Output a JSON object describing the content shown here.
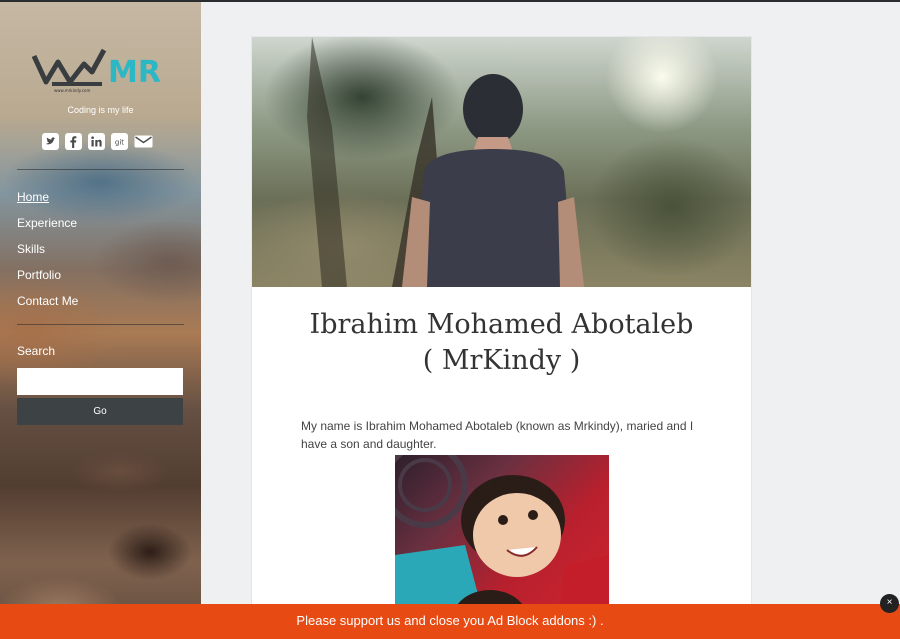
{
  "site": {
    "logo_text": "MR",
    "logo_arabic": "كندي",
    "logo_url_text": "www.mrkindy.com",
    "tagline": "Coding is my life"
  },
  "social": [
    {
      "name": "twitter-icon"
    },
    {
      "name": "facebook-icon"
    },
    {
      "name": "linkedin-icon"
    },
    {
      "name": "git-icon",
      "label": "git"
    },
    {
      "name": "email-icon"
    }
  ],
  "nav": {
    "items": [
      {
        "label": "Home",
        "active": true
      },
      {
        "label": "Experience"
      },
      {
        "label": "Skills"
      },
      {
        "label": "Portfolio"
      },
      {
        "label": "Contact Me"
      }
    ]
  },
  "search": {
    "label": "Search",
    "value": "",
    "button_label": "Go"
  },
  "post": {
    "title_line1": "Ibrahim Mohamed Abotaleb",
    "title_line2": "( MrKindy )",
    "intro": "My name is Ibrahim Mohamed Abotaleb (known as Mrkindy), maried and I have a son and daughter."
  },
  "adblock": {
    "message": "Please support us and close you Ad Block addons :) .",
    "close_label": "×"
  },
  "colors": {
    "accent": "#e84a14",
    "logo_teal": "#2bb8c4",
    "button_dark": "#3d4245"
  }
}
